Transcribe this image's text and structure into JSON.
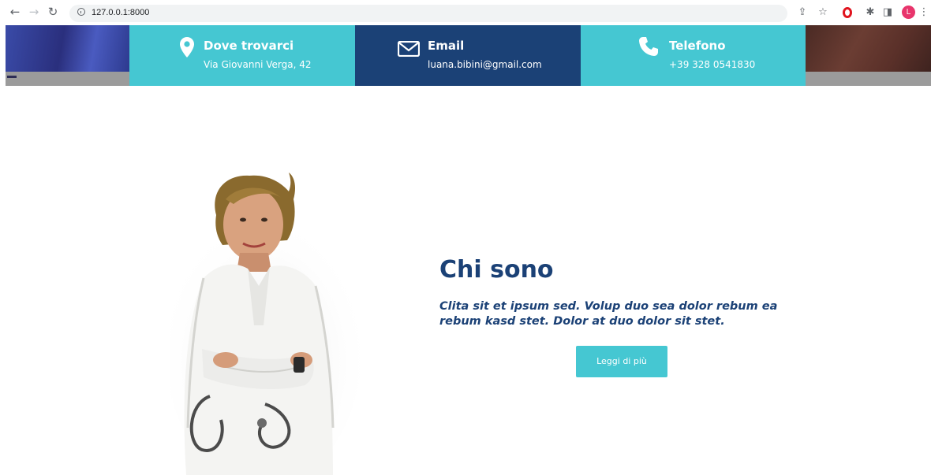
{
  "browser": {
    "url": "127.0.0.1:8000",
    "profile_initial": "L"
  },
  "contacts": {
    "address": {
      "title": "Dove trovarci",
      "value": "Via Giovanni Verga, 42",
      "icon": "map-pin-icon",
      "color": "#45c7d2"
    },
    "email": {
      "title": "Email",
      "value": "luana.bibini@gmail.com",
      "icon": "envelope-icon",
      "color": "#1b4176"
    },
    "phone": {
      "title": "Telefono",
      "value": "+39 328 0541830",
      "icon": "phone-icon",
      "color": "#45c7d2"
    }
  },
  "about": {
    "title": "Chi sono",
    "text": "Clita sit et ipsum sed. Volup duo sea dolor rebum ea rebum kasd stet. Dolor at duo dolor sit stet.",
    "button_label": "Leggi di più",
    "title_color": "#1b4176",
    "button_color": "#45c7d2"
  }
}
